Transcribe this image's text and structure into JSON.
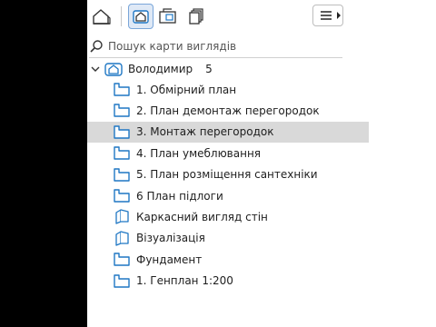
{
  "search": {
    "placeholder": "Пошук карти виглядів"
  },
  "tree": {
    "root": {
      "label": "Володимир",
      "count": "5"
    },
    "items": [
      {
        "label": "1. Обмірний план",
        "icon": "floor-plan-icon"
      },
      {
        "label": "2. План демонтаж перегородок",
        "icon": "floor-plan-icon"
      },
      {
        "label": "3. Монтаж перегородок",
        "icon": "floor-plan-icon",
        "selected": true
      },
      {
        "label": "4. План умеблювання",
        "icon": "floor-plan-icon"
      },
      {
        "label": "5. План розміщення сантехніки",
        "icon": "floor-plan-icon"
      },
      {
        "label": "6 План підлоги",
        "icon": "floor-plan-icon"
      },
      {
        "label": "Каркасний вигляд стін",
        "icon": "3d-view-icon"
      },
      {
        "label": "Візуалізація",
        "icon": "3d-view-icon"
      },
      {
        "label": "Фундамент",
        "icon": "floor-plan-icon"
      },
      {
        "label": "1. Генплан 1:200",
        "icon": "floor-plan-icon"
      }
    ]
  },
  "colors": {
    "icon": "#1f77c4",
    "selected_row": "#d9d9d9",
    "active_tab": "#dfe9f6"
  }
}
